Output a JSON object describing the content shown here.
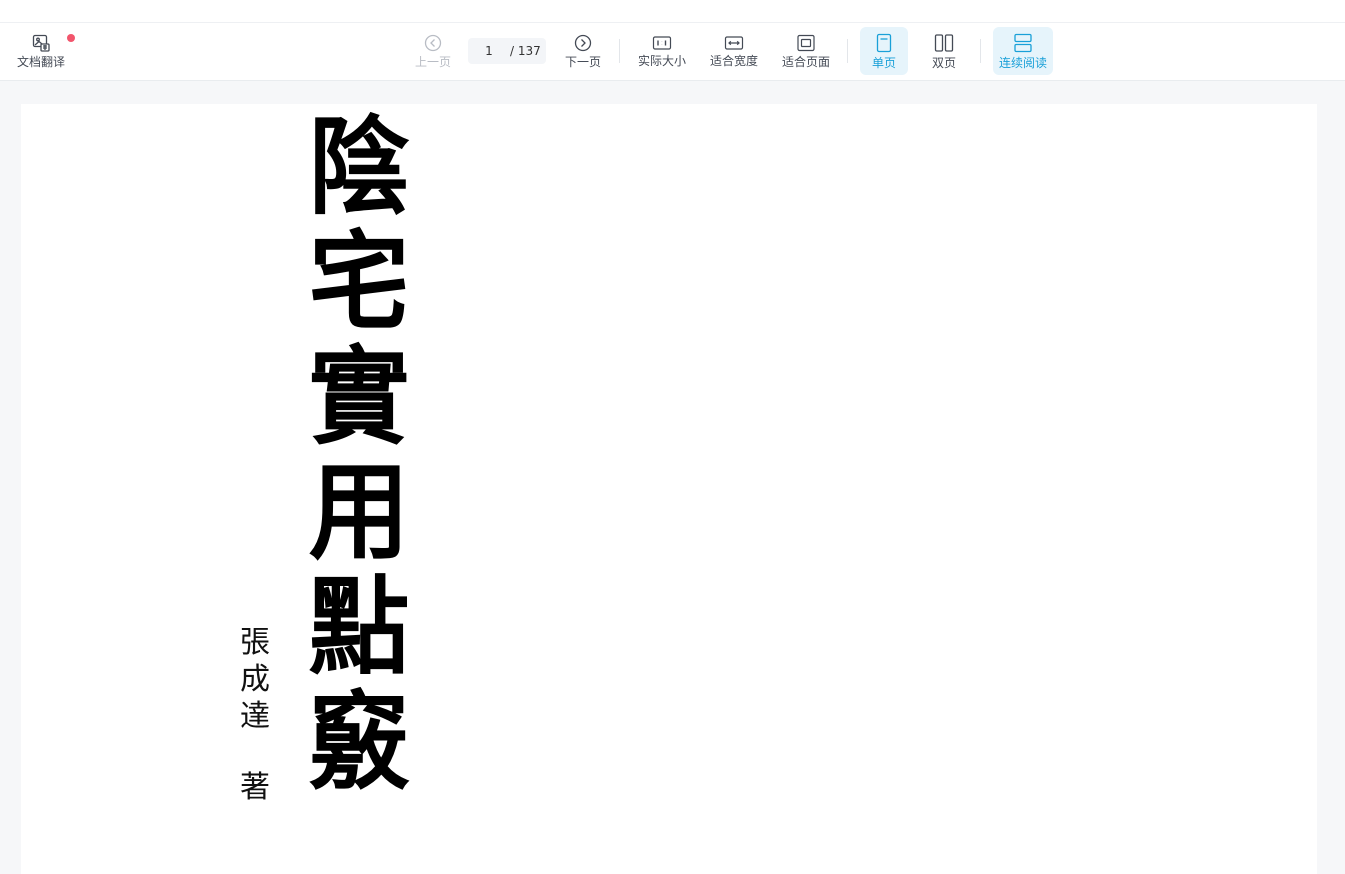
{
  "toolbar": {
    "translate": {
      "label": "文档翻译",
      "icon": "image-translate-icon"
    },
    "prev": {
      "label": "上一页",
      "icon": "chevron-left-circle-icon",
      "enabled": false
    },
    "page_current": "1",
    "page_total": "/ 137",
    "next": {
      "label": "下一页",
      "icon": "chevron-right-circle-icon"
    },
    "actual_size": {
      "label": "实际大小",
      "icon": "actual-size-icon"
    },
    "fit_width": {
      "label": "适合宽度",
      "icon": "fit-width-icon"
    },
    "fit_page": {
      "label": "适合页面",
      "icon": "fit-page-icon"
    },
    "single_page": {
      "label": "单页",
      "icon": "single-page-icon",
      "active": true
    },
    "double_page": {
      "label": "双页",
      "icon": "double-page-icon",
      "active": false
    },
    "continuous": {
      "label": "连续阅读",
      "icon": "continuous-read-icon",
      "active": true
    }
  },
  "document": {
    "title_chars": [
      "陰",
      "宅",
      "實",
      "用",
      "點",
      "竅"
    ],
    "author_chars": [
      "張",
      "成",
      "達"
    ],
    "author_suffix": "著"
  },
  "colors": {
    "accent": "#1aa0d8",
    "active_bg": "#e6f4fb",
    "badge": "#f2556c",
    "viewer_bg": "#f6f7f9"
  }
}
